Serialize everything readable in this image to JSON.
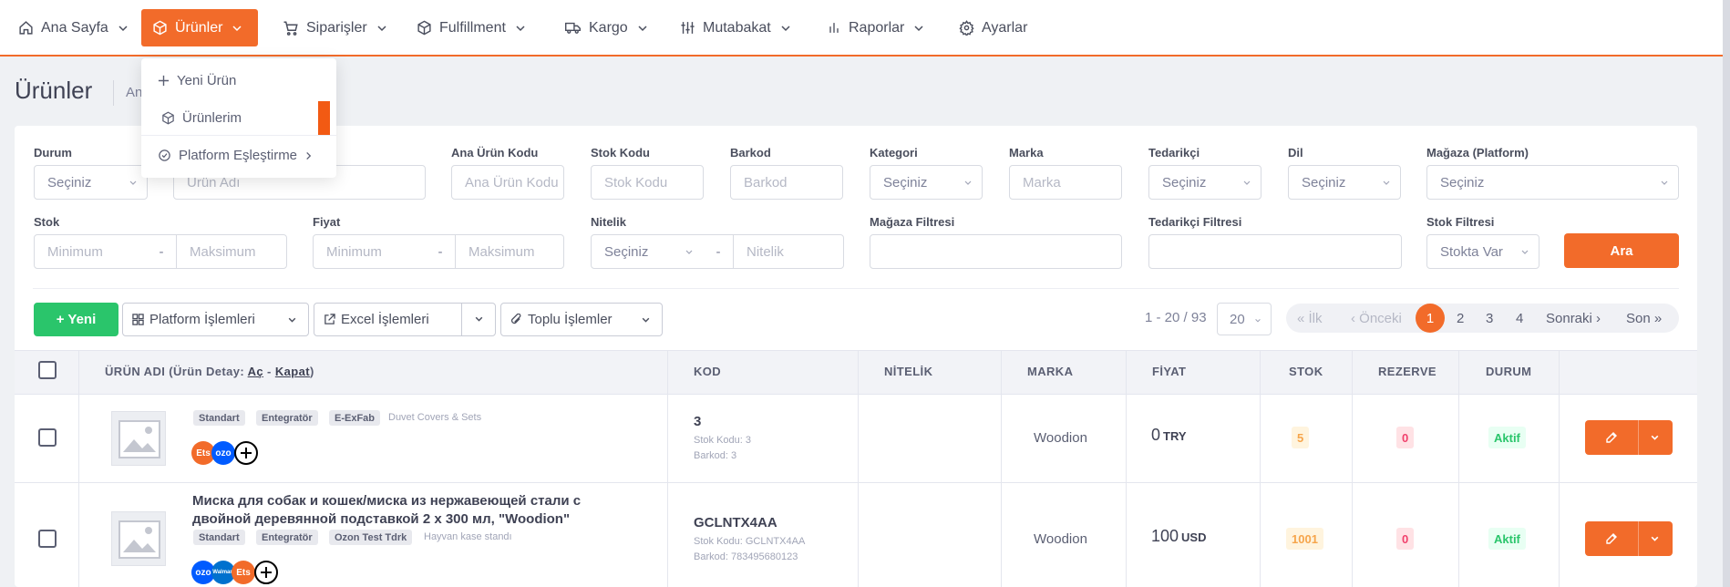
{
  "nav": {
    "items": [
      {
        "label": "Ana Sayfa",
        "icon": "home-icon"
      },
      {
        "label": "Ürünler",
        "icon": "box-icon",
        "active": true
      },
      {
        "label": "Siparişler",
        "icon": "cart-icon"
      },
      {
        "label": "Fulfillment",
        "icon": "cube-icon"
      },
      {
        "label": "Kargo",
        "icon": "truck-icon"
      },
      {
        "label": "Mutabakat",
        "icon": "sliders-icon"
      },
      {
        "label": "Raporlar",
        "icon": "bar-chart-icon"
      },
      {
        "label": "Ayarlar",
        "icon": "gear-icon"
      }
    ],
    "accent": "#f26b2a"
  },
  "page": {
    "title": "Ürünler",
    "crumb": "An"
  },
  "dropdown": {
    "items": [
      {
        "label": "Yeni Ürün",
        "icon": "plus-icon"
      },
      {
        "label": "Ürünlerim",
        "icon": "box-icon"
      },
      {
        "label": "Platform Eşleştirme",
        "icon": "check-circle-icon"
      }
    ]
  },
  "filters": {
    "durum": {
      "label": "Durum",
      "value": "Seçiniz"
    },
    "urun_adi": {
      "placeholder": "Ürün Adı"
    },
    "ana_urun_kodu": {
      "label": "Ana Ürün Kodu",
      "placeholder": "Ana Ürün Kodu"
    },
    "stok_kodu": {
      "label": "Stok Kodu",
      "placeholder": "Stok Kodu"
    },
    "barkod": {
      "label": "Barkod",
      "placeholder": "Barkod"
    },
    "kategori": {
      "label": "Kategori",
      "value": "Seçiniz"
    },
    "marka": {
      "label": "Marka",
      "placeholder": "Marka"
    },
    "tedarikci": {
      "label": "Tedarikçi",
      "value": "Seçiniz"
    },
    "dil": {
      "label": "Dil",
      "value": "Seçiniz"
    },
    "magaza": {
      "label": "Mağaza (Platform)",
      "value": "Seçiniz"
    },
    "stok": {
      "label": "Stok",
      "min": "Minimum",
      "max": "Maksimum"
    },
    "fiyat": {
      "label": "Fiyat",
      "min": "Minimum",
      "max": "Maksimum"
    },
    "nitelik": {
      "label": "Nitelik",
      "value": "Seçiniz",
      "placeholder": "Nitelik"
    },
    "magaza_filtresi": {
      "label": "Mağaza Filtresi"
    },
    "tedarikci_filtresi": {
      "label": "Tedarikçi Filtresi"
    },
    "stok_filtresi": {
      "label": "Stok Filtresi",
      "value": "Stokta Var"
    },
    "dash": "-",
    "search_label": "Ara"
  },
  "toolbar": {
    "new_label": "+ Yeni",
    "platform_label": "Platform İşlemleri",
    "excel_label": "Excel İşlemleri",
    "bulk_label": "Toplu İşlemler",
    "range": "1 - 20 / 93",
    "page_size": "20",
    "pager": {
      "first": "« İlk",
      "prev": "‹ Önceki",
      "current": "1",
      "p2": "2",
      "p3": "3",
      "p4": "4",
      "next": "Sonraki ›",
      "last": "Son »"
    }
  },
  "table": {
    "headers": {
      "name_prefix": "ÜRÜN ADI (Ürün Detay: ",
      "open": "Aç",
      "dash": " - ",
      "close": "Kapat",
      "suffix": ")",
      "code": "KOD",
      "attribute": "NİTELİK",
      "brand": "MARKA",
      "price": "FİYAT",
      "stock": "STOK",
      "reserve": "REZERVE",
      "status": "DURUM"
    },
    "rows": [
      {
        "name": "",
        "tags": [
          "Standart",
          "Entegratör",
          "E-ExFab"
        ],
        "category": "Duvet Covers & Sets",
        "marketplaces": [
          "Ets",
          "ozo"
        ],
        "code": "3",
        "stock_code": "Stok Kodu: 3",
        "barcode": "Barkod: 3",
        "brand": "Woodion",
        "price": "0",
        "currency": "TRY",
        "stock": "5",
        "reserve": "0",
        "status": "Aktif"
      },
      {
        "name_line1": "Миска для собак и кошек/миска из нержавеющей стали с",
        "name_line2": "двойной деревянной подставкой 2 х 300 мл, \"Woodion\"",
        "tags": [
          "Standart",
          "Entegratör",
          "Ozon Test Tdrk"
        ],
        "category": "Hayvan kase standı",
        "marketplaces": [
          "ozo",
          "Walmart",
          "Ets"
        ],
        "code": "GCLNTX4AA",
        "stock_code": "Stok Kodu: GCLNTX4AA",
        "barcode": "Barkod: 783495680123",
        "brand": "Woodion",
        "price": "100",
        "currency": "USD",
        "stock": "1001",
        "reserve": "0",
        "status": "Aktif"
      }
    ]
  }
}
